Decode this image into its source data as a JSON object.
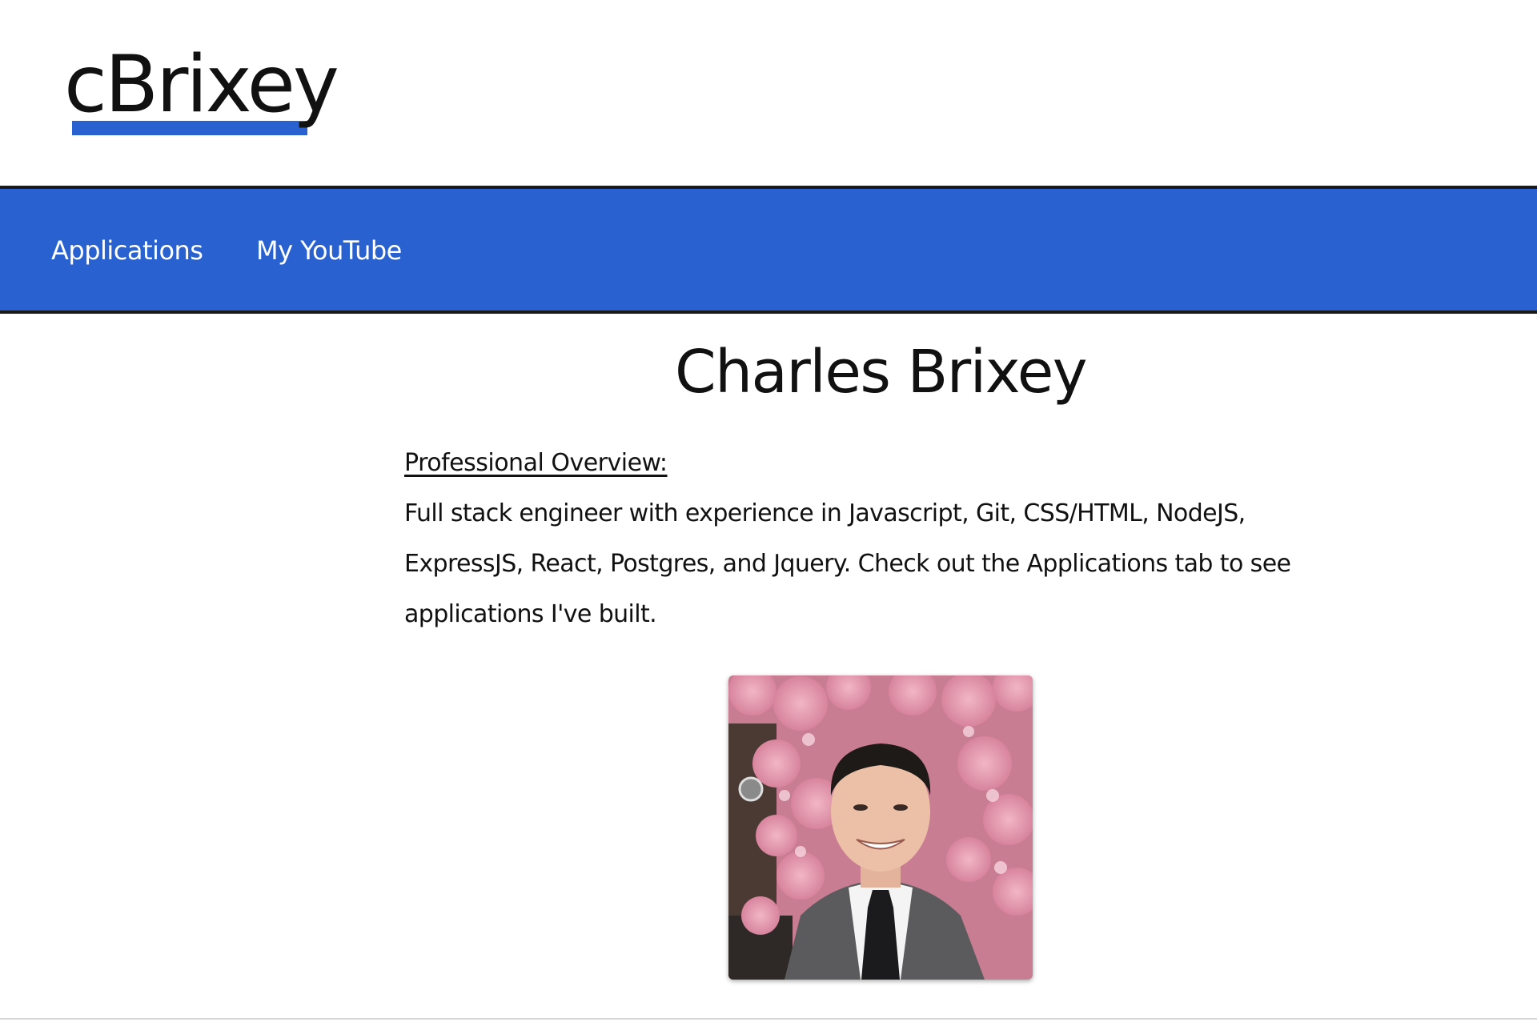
{
  "header": {
    "logo_text": "cBrixey",
    "logo_accent_color": "#2962d0"
  },
  "nav": {
    "background_color": "#2962d0",
    "items": [
      {
        "label": "Applications"
      },
      {
        "label": "My YouTube"
      }
    ]
  },
  "main": {
    "title": "Charles Brixey",
    "overview_heading": "Professional Overview:",
    "overview_body": "Full stack engineer with experience in Javascript, Git, CSS/HTML, NodeJS, ExpressJS, React, Postgres, and Jquery. Check out the Applications tab to see applications I've built.",
    "photo_icon": "profile-photo"
  }
}
